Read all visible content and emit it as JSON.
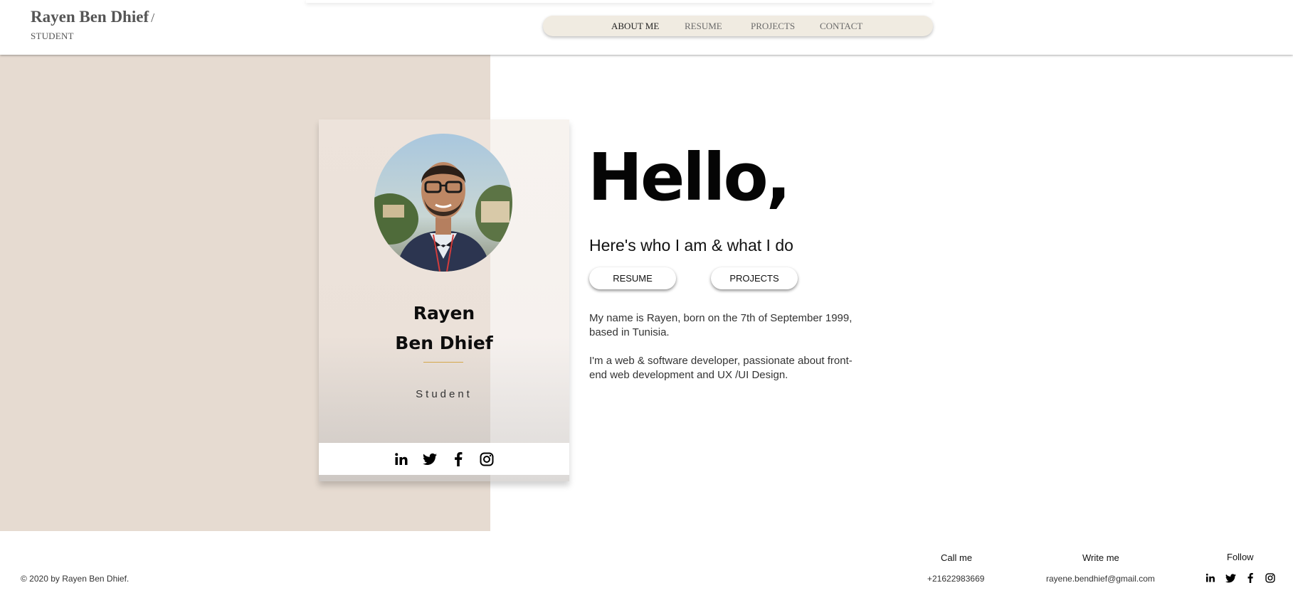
{
  "header": {
    "brand_name": "Rayen Ben Dhief",
    "brand_slash": "/",
    "brand_subtitle": "STUDENT",
    "nav": [
      {
        "label": "ABOUT ME",
        "active": true
      },
      {
        "label": "RESUME",
        "active": false
      },
      {
        "label": "PROJECTS",
        "active": false
      },
      {
        "label": "CONTACT",
        "active": false
      }
    ]
  },
  "card": {
    "first_name": "Rayen",
    "last_name": "Ben Dhief",
    "role": "Student",
    "photo_icon": "profile-photo",
    "social": [
      "linkedin-icon",
      "twitter-icon",
      "facebook-icon",
      "instagram-icon"
    ]
  },
  "main": {
    "greeting": "Hello,",
    "subtitle": "Here's who I am & what I do",
    "buttons": [
      {
        "label": "RESUME"
      },
      {
        "label": "PROJECTS"
      }
    ],
    "paragraph_1": "My name is Rayen, born on the 7th of September 1999, based in Tunisia.",
    "paragraph_2": "I'm a web & software developer, passionate about front-end web development and UX /UI Design."
  },
  "footer": {
    "copyright": "© 2020 by Rayen Ben Dhief.",
    "call_label": "Call me",
    "call_value": "+21622983669",
    "write_label": "Write me",
    "write_value": "rayene.bendhief@gmail.com",
    "follow_label": "Follow",
    "social": [
      "linkedin-icon",
      "twitter-icon",
      "facebook-icon",
      "instagram-icon"
    ]
  },
  "colors": {
    "beige_panel": "#e6dbd1",
    "nav_bg": "#f0ebe1",
    "accent_line": "#d4a84b"
  }
}
